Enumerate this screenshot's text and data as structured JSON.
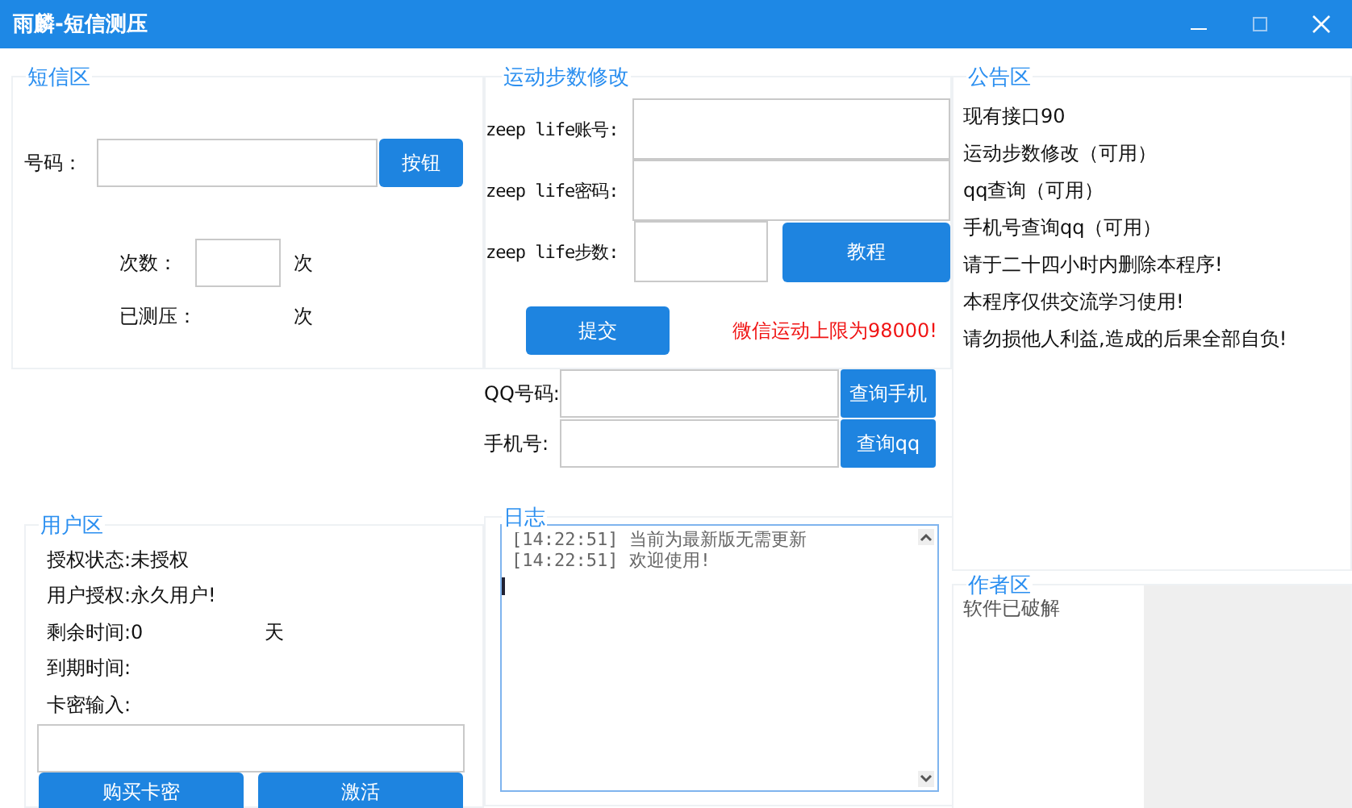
{
  "window": {
    "title": "雨麟-短信测压"
  },
  "sms": {
    "title": "短信区",
    "phone_label": "号码：",
    "phone_button": "按钮",
    "count_label": "次数：",
    "count_unit": "次",
    "done_label": "已测压：",
    "done_unit": "次"
  },
  "steps": {
    "title": "运动步数修改",
    "fields": [
      {
        "label": "zeep life账号:"
      },
      {
        "label": "zeep life密码:"
      },
      {
        "label": "zeep life步数:"
      }
    ],
    "tutorial_button": "教程",
    "submit_button": "提交",
    "limit_note": "微信运动上限为98000!"
  },
  "query": {
    "rows": [
      {
        "label": "QQ号码:",
        "button": "查询手机"
      },
      {
        "label": "手机号:",
        "button": "查询qq"
      }
    ]
  },
  "user": {
    "title": "用户区",
    "lines": [
      {
        "text": "授权状态:未授权"
      },
      {
        "text": "用户授权:永久用户!"
      },
      {
        "text": "剩余时间:0",
        "unit": "天"
      },
      {
        "text": "到期时间:"
      },
      {
        "text": "卡密输入:"
      }
    ],
    "buy_button": "购买卡密",
    "activate_button": "激活"
  },
  "log": {
    "title": "日志",
    "lines": [
      "[14:22:51] 当前为最新版无需更新",
      "[14:22:51] 欢迎使用!"
    ]
  },
  "notice": {
    "title": "公告区",
    "lines": [
      "现有接口90",
      "运动步数修改（可用）",
      "qq查询（可用）",
      "手机号查询qq（可用）",
      "请于二十四小时内删除本程序!",
      "本程序仅供交流学习使用!",
      "请勿损他人利益,造成的后果全部自负!"
    ]
  },
  "author": {
    "title": "作者区",
    "text": "软件已破解"
  }
}
